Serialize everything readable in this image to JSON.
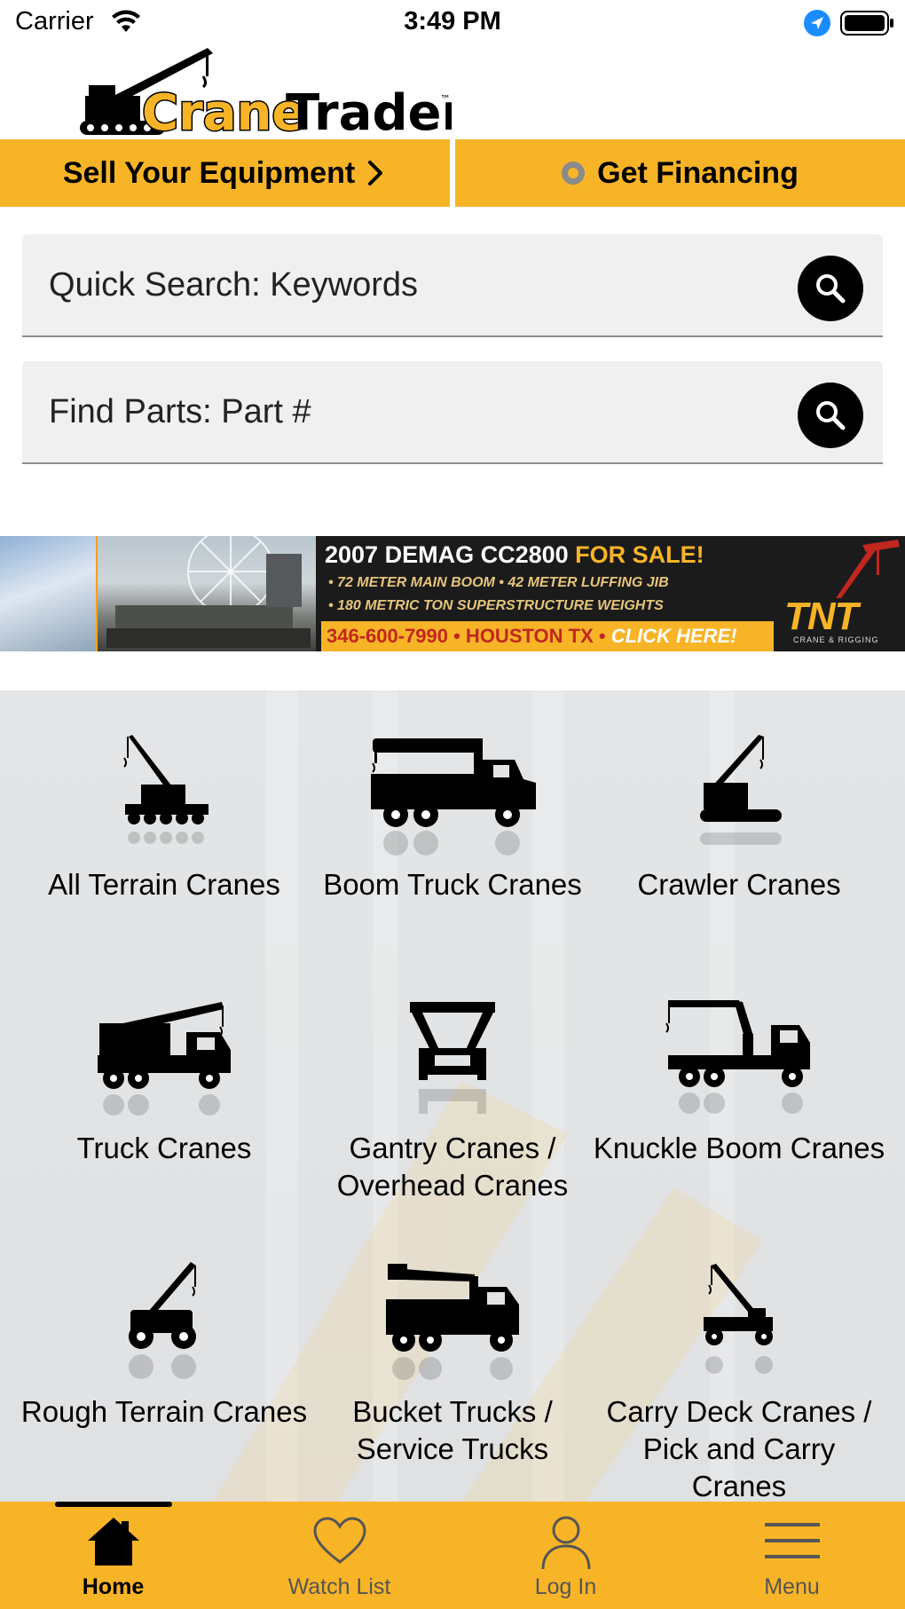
{
  "status_bar": {
    "carrier": "Carrier",
    "time": "3:49 PM"
  },
  "brand": {
    "name_part1": "Crane",
    "name_part2": "Trader",
    "trademark": "™",
    "color": "#F8B427"
  },
  "actions": {
    "sell": "Sell Your Equipment",
    "financing": "Get Financing"
  },
  "search": {
    "quick_placeholder": "Quick Search: Keywords",
    "parts_placeholder": "Find Parts: Part #"
  },
  "banner": {
    "title_lead": "2007 DEMAG CC2800",
    "title_highlight": "FOR SALE!",
    "bullet1": "• 72 METER MAIN BOOM • 42 METER LUFFING JIB",
    "bullet2": "• 180 METRIC TON SUPERSTRUCTURE WEIGHTS",
    "phone": "346-600-7990 • HOUSTON TX • ",
    "click": "CLICK HERE!",
    "logo_text": "TNT",
    "logo_sub": "CRANE & RIGGING"
  },
  "categories": [
    {
      "label": "All Terrain Cranes",
      "icon": "all-terrain-crane-icon"
    },
    {
      "label": "Boom Truck Cranes",
      "icon": "boom-truck-icon"
    },
    {
      "label": "Crawler Cranes",
      "icon": "crawler-crane-icon"
    },
    {
      "label": "Truck Cranes",
      "icon": "truck-crane-icon"
    },
    {
      "label": "Gantry Cranes / Overhead Cranes",
      "icon": "gantry-crane-icon"
    },
    {
      "label": "Knuckle Boom Cranes",
      "icon": "knuckle-boom-icon"
    },
    {
      "label": "Rough Terrain Cranes",
      "icon": "rough-terrain-crane-icon"
    },
    {
      "label": "Bucket Trucks / Service Trucks",
      "icon": "bucket-truck-icon"
    },
    {
      "label": "Carry Deck Cranes / Pick and Carry Cranes",
      "icon": "carry-deck-crane-icon"
    }
  ],
  "tabs": [
    {
      "label": "Home",
      "icon": "home-icon",
      "active": true
    },
    {
      "label": "Watch List",
      "icon": "heart-icon",
      "active": false
    },
    {
      "label": "Log In",
      "icon": "user-icon",
      "active": false
    },
    {
      "label": "Menu",
      "icon": "hamburger-menu-icon",
      "active": false
    }
  ]
}
